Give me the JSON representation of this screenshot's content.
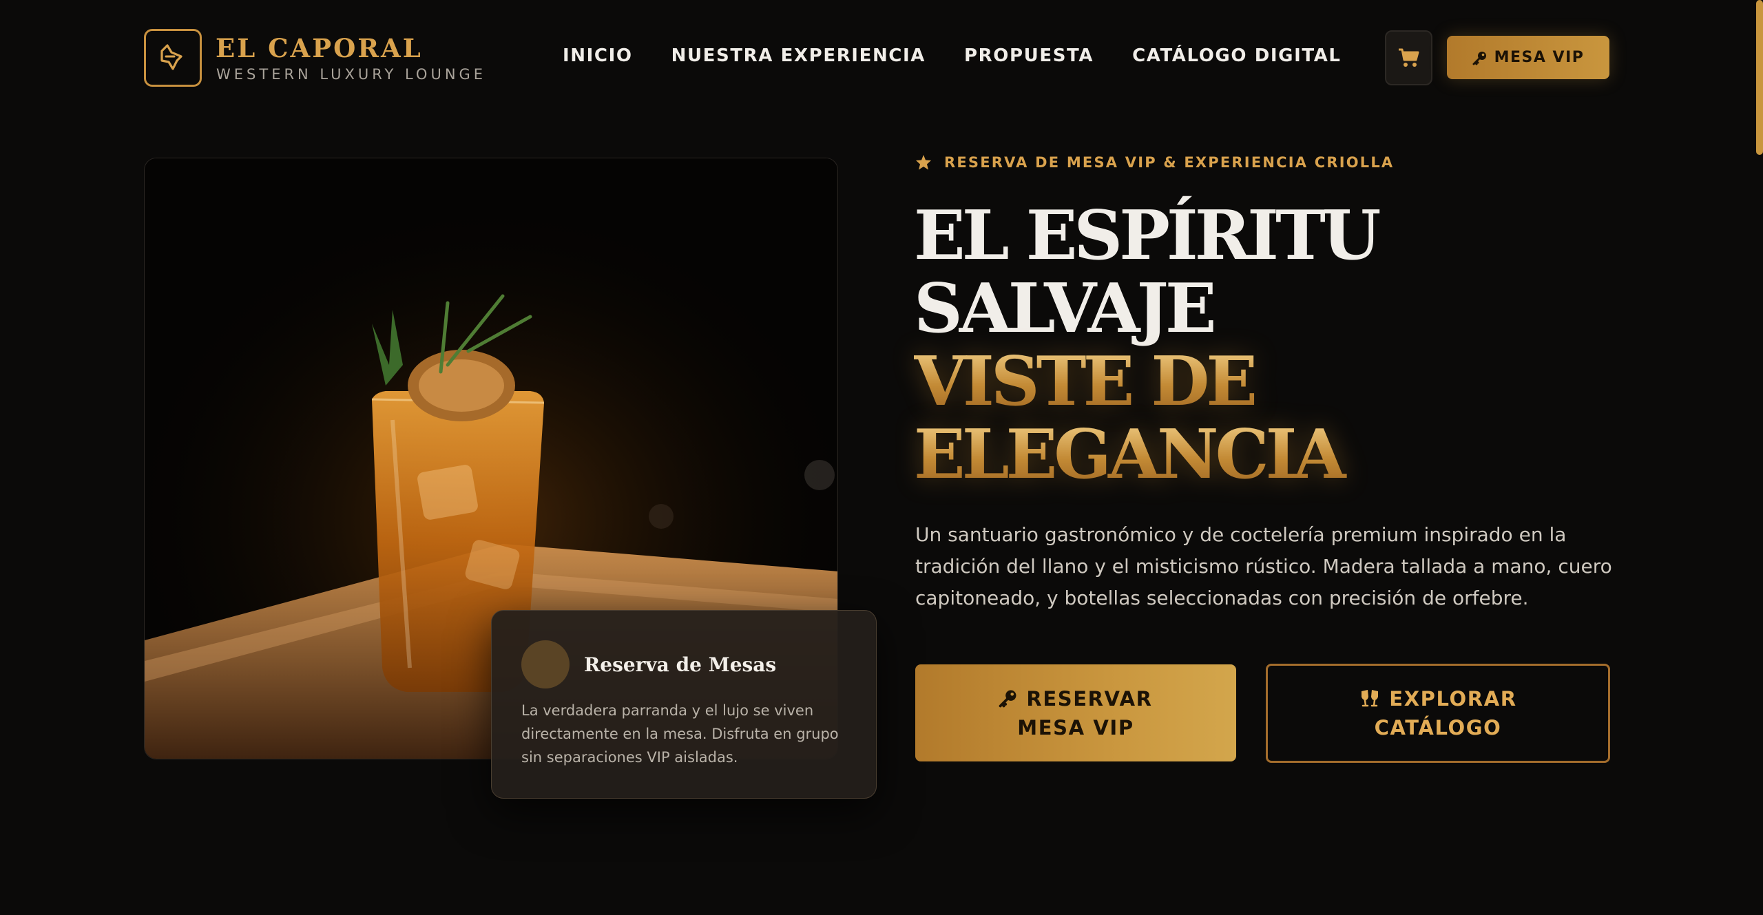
{
  "brand": {
    "title": "EL CAPORAL",
    "subtitle": "WESTERN LUXURY LOUNGE",
    "logo_icon": "bull-horn-icon"
  },
  "nav": {
    "items": [
      {
        "label": "INICIO"
      },
      {
        "label": "NUESTRA EXPERIENCIA"
      },
      {
        "label": "PROPUESTA"
      },
      {
        "label": "CATÁLOGO DIGITAL"
      }
    ]
  },
  "header": {
    "cart_icon": "cart-icon",
    "vip_label": "MESA VIP",
    "vip_icon": "key-icon"
  },
  "hero": {
    "eyebrow": "RESERVA DE MESA VIP & EXPERIENCIA CRIOLLA",
    "headline_line1": "EL ESPÍRITU",
    "headline_line2": "SALVAJE",
    "headline_line3": "VISTE DE",
    "headline_line4": "ELEGANCIA",
    "description": "Un santuario gastronómico y de coctelería premium inspirado en la tradición del llano y el misticismo rústico. Madera tallada a mano, cuero capitoneado, y botellas seleccionadas con precisión de orfebre.",
    "primary_button": "RESERVAR MESA VIP",
    "secondary_button": "EXPLORAR CATÁLOGO"
  },
  "card": {
    "title": "Reserva de Mesas",
    "text": "La verdadera parranda y el lujo se viven directamente en la mesa. Disfruta en grupo sin separaciones VIP aisladas."
  },
  "colors": {
    "background": "#0b0a09",
    "accent_gold": "#c9963e",
    "text_light": "#f1eee9"
  }
}
